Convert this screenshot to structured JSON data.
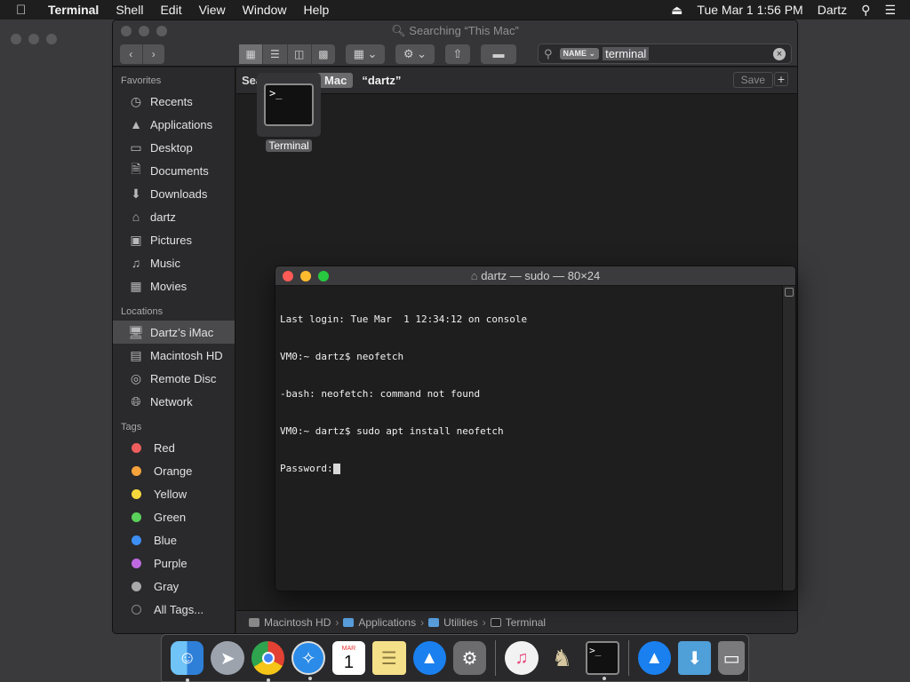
{
  "menubar": {
    "apple": "",
    "app": "Terminal",
    "items": [
      "Shell",
      "Edit",
      "View",
      "Window",
      "Help"
    ],
    "datetime": "Tue Mar 1  1:56 PM",
    "user": "Dartz"
  },
  "finder": {
    "title": "Searching “This Mac”",
    "search": {
      "token": "NAME ⌄",
      "term": "terminal"
    },
    "scope": {
      "label": "Search:",
      "scope": "This Mac",
      "query": "“dartz”",
      "save": "Save",
      "plus": "+"
    },
    "sidebar": {
      "favorites_label": "Favorites",
      "favorites": [
        "Recents",
        "Applications",
        "Desktop",
        "Documents",
        "Downloads",
        "dartz",
        "Pictures",
        "Music",
        "Movies"
      ],
      "locations_label": "Locations",
      "locations": [
        "Dartz’s iMac",
        "Macintosh HD",
        "Remote Disc",
        "Network"
      ],
      "tags_label": "Tags",
      "tags": [
        "Red",
        "Orange",
        "Yellow",
        "Green",
        "Blue",
        "Purple",
        "Gray",
        "All Tags..."
      ]
    },
    "result": {
      "name": "Terminal",
      "glyph": ">_"
    },
    "pathbar": [
      "Macintosh HD",
      "Applications",
      "Utilities",
      "Terminal"
    ]
  },
  "terminal": {
    "title": "dartz — sudo — 80×24",
    "lines": [
      "Last login: Tue Mar  1 12:34:12 on console",
      "VM0:~ dartz$ neofetch",
      "-bash: neofetch: command not found",
      "VM0:~ dartz$ sudo apt install neofetch",
      "Password:"
    ]
  },
  "dock": {
    "calendar": {
      "month": "MAR",
      "day": "1"
    }
  },
  "colors": {
    "tag_red": "#f05d5d",
    "tag_orange": "#f7a33b",
    "tag_yellow": "#f6d73c",
    "tag_green": "#5ad15a",
    "tag_blue": "#3d8ff5",
    "tag_purple": "#bf69e0",
    "tag_gray": "#a9a9a9",
    "close": "#fd5b56",
    "minimize": "#fdbc2e",
    "zoom": "#28c840"
  }
}
